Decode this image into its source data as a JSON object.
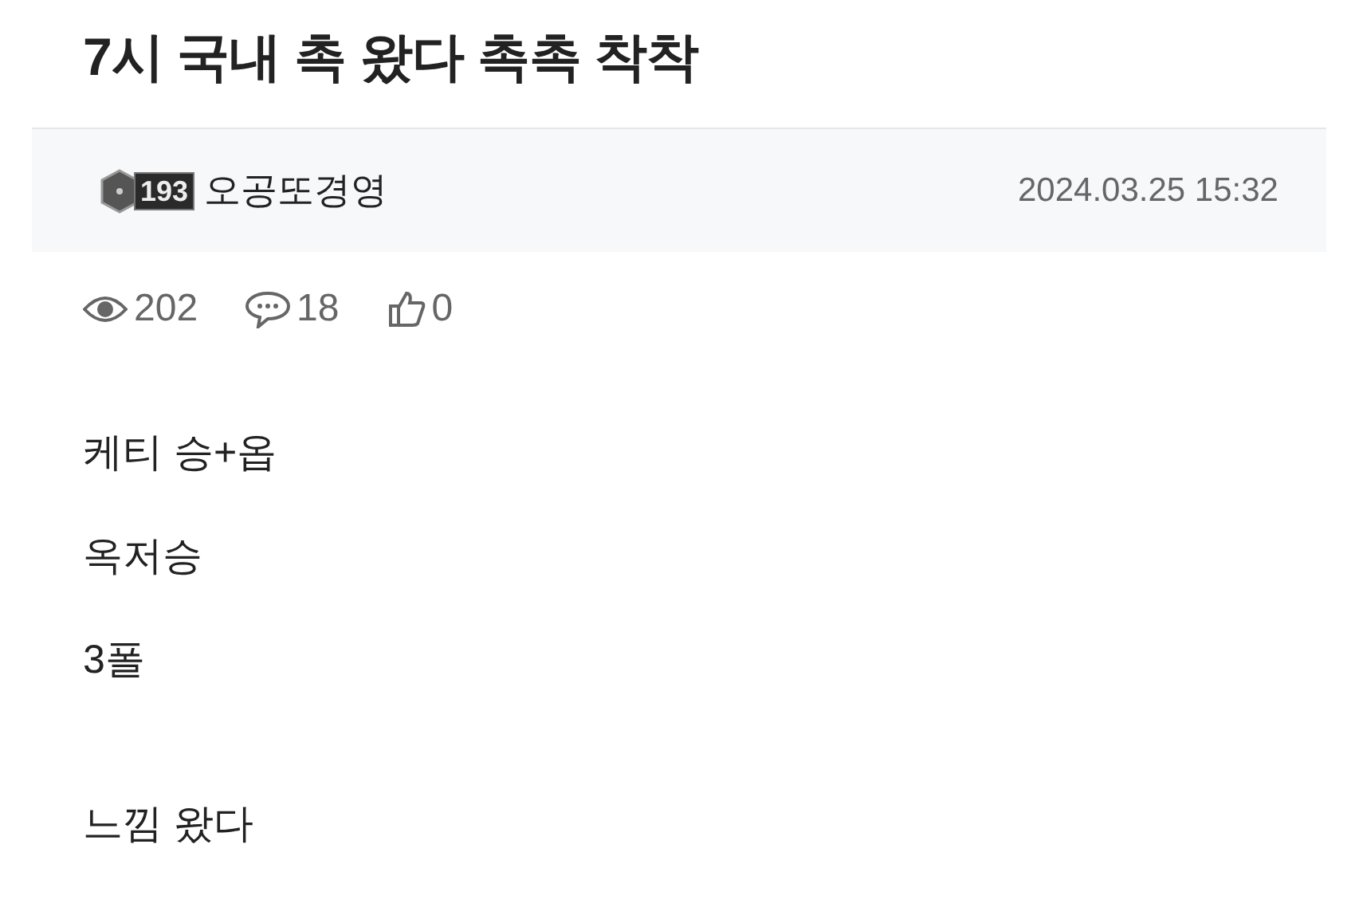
{
  "title": "7시 국내 촉 왔다 촉촉 착착",
  "author": {
    "level": "193",
    "name": "오공또경영",
    "date": "2024.03.25 15:32"
  },
  "stats": {
    "views": "202",
    "comments": "18",
    "likes": "0"
  },
  "body_blocks": [
    [
      "케티 승+옵",
      "옥저승",
      "3폴"
    ],
    [
      "느낌 왔다"
    ]
  ]
}
